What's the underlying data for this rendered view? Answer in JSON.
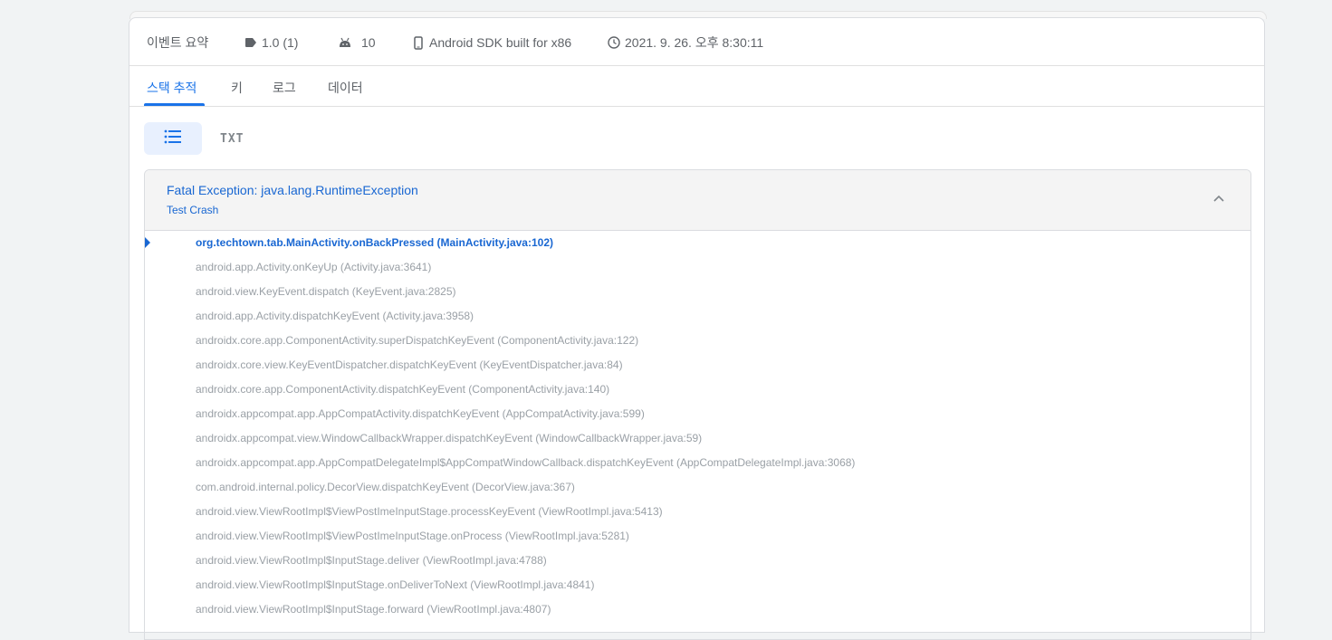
{
  "meta": {
    "event_summary_label": "이벤트 요약",
    "version": "1.0 (1)",
    "android_version": "10",
    "device": "Android SDK built for x86",
    "timestamp": "2021. 9. 26. 오후 8:30:11"
  },
  "tabs": [
    {
      "label": "스택 추적",
      "active": true
    },
    {
      "label": "키",
      "active": false
    },
    {
      "label": "로그",
      "active": false
    },
    {
      "label": "데이터",
      "active": false
    }
  ],
  "view": {
    "txt_label": "TXT"
  },
  "exception": {
    "title": "Fatal Exception: java.lang.RuntimeException",
    "message": "Test Crash"
  },
  "frames": [
    "org.techtown.tab.MainActivity.onBackPressed (MainActivity.java:102)",
    "android.app.Activity.onKeyUp (Activity.java:3641)",
    "android.view.KeyEvent.dispatch (KeyEvent.java:2825)",
    "android.app.Activity.dispatchKeyEvent (Activity.java:3958)",
    "androidx.core.app.ComponentActivity.superDispatchKeyEvent (ComponentActivity.java:122)",
    "androidx.core.view.KeyEventDispatcher.dispatchKeyEvent (KeyEventDispatcher.java:84)",
    "androidx.core.app.ComponentActivity.dispatchKeyEvent (ComponentActivity.java:140)",
    "androidx.appcompat.app.AppCompatActivity.dispatchKeyEvent (AppCompatActivity.java:599)",
    "androidx.appcompat.view.WindowCallbackWrapper.dispatchKeyEvent (WindowCallbackWrapper.java:59)",
    "androidx.appcompat.app.AppCompatDelegateImpl$AppCompatWindowCallback.dispatchKeyEvent (AppCompatDelegateImpl.java:3068)",
    "com.android.internal.policy.DecorView.dispatchKeyEvent (DecorView.java:367)",
    "android.view.ViewRootImpl$ViewPostImeInputStage.processKeyEvent (ViewRootImpl.java:5413)",
    "android.view.ViewRootImpl$ViewPostImeInputStage.onProcess (ViewRootImpl.java:5281)",
    "android.view.ViewRootImpl$InputStage.deliver (ViewRootImpl.java:4788)",
    "android.view.ViewRootImpl$InputStage.onDeliverToNext (ViewRootImpl.java:4841)",
    "android.view.ViewRootImpl$InputStage.forward (ViewRootImpl.java:4807)"
  ],
  "colors": {
    "accent": "#1a73e8",
    "link": "#1967d2",
    "muted": "#9aa0a6"
  }
}
